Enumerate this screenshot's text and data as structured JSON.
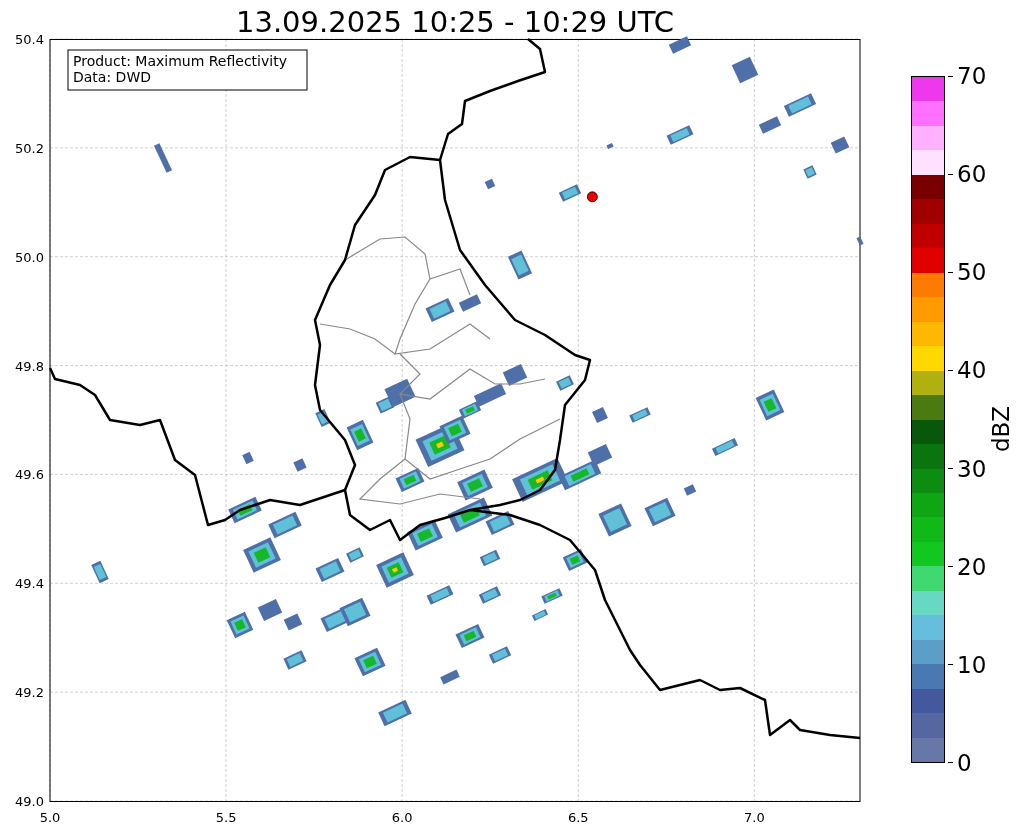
{
  "title": "13.09.2025 10:25 - 10:29 UTC",
  "map_chart": {
    "chart_data": {
      "type": "scatter",
      "xlim": [
        5.0,
        7.3
      ],
      "ylim": [
        49.0,
        50.4
      ],
      "xticks": [
        {
          "value": 5.0,
          "label": "5.0"
        },
        {
          "value": 5.5,
          "label": "5.5"
        },
        {
          "value": 6.0,
          "label": "6.0"
        },
        {
          "value": 6.5,
          "label": "6.5"
        },
        {
          "value": 7.0,
          "label": "7.0"
        }
      ],
      "yticks": [
        {
          "value": 49.0,
          "label": "49.0"
        },
        {
          "value": 49.2,
          "label": "49.2"
        },
        {
          "value": 49.4,
          "label": "49.4"
        },
        {
          "value": 49.6,
          "label": "49.6"
        },
        {
          "value": 49.8,
          "label": "49.8"
        },
        {
          "value": 50.0,
          "label": "50.0"
        },
        {
          "value": 50.2,
          "label": "50.2"
        },
        {
          "value": 50.4,
          "label": "50.4"
        }
      ],
      "x": [
        6.54
      ],
      "grid": true,
      "series": [
        {
          "color": "#ee0000",
          "values": [
            50.11
          ]
        }
      ]
    },
    "info_box": [
      "Product: Maximum Reflectivity",
      "Data: DWD"
    ]
  },
  "colorbar": {
    "label": "dBZ",
    "ticks": [
      "70",
      "60",
      "50",
      "40",
      "30",
      "20",
      "10",
      "0"
    ],
    "segments": [
      {
        "color": "#ee38ee"
      },
      {
        "color": "#ff70ff"
      },
      {
        "color": "#ffb0ff"
      },
      {
        "color": "#ffe0ff"
      },
      {
        "color": "#780000"
      },
      {
        "color": "#a00000"
      },
      {
        "color": "#c00000"
      },
      {
        "color": "#e00000"
      },
      {
        "color": "#ff7a00"
      },
      {
        "color": "#ff9a00"
      },
      {
        "color": "#ffb800"
      },
      {
        "color": "#ffd800"
      },
      {
        "color": "#b0b010"
      },
      {
        "color": "#4a7a10"
      },
      {
        "color": "#08580c"
      },
      {
        "color": "#0a740e"
      },
      {
        "color": "#0c8c10"
      },
      {
        "color": "#0ea612"
      },
      {
        "color": "#10b818"
      },
      {
        "color": "#12c820"
      },
      {
        "color": "#40d870"
      },
      {
        "color": "#66d8c4"
      },
      {
        "color": "#66bedd"
      },
      {
        "color": "#5b9fc8"
      },
      {
        "color": "#4a78b0"
      },
      {
        "color": "#44589e"
      },
      {
        "color": "#5566a0"
      },
      {
        "color": "#6677a8"
      }
    ]
  }
}
